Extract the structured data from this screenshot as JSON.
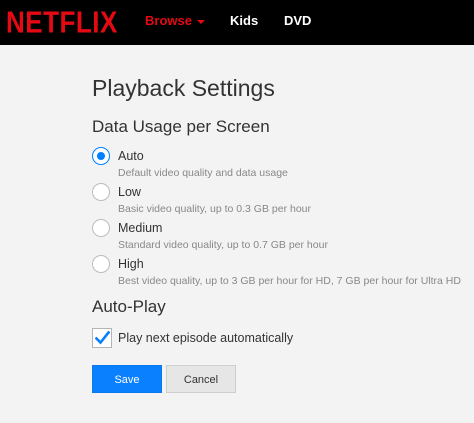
{
  "header": {
    "logo": "NETFLIX",
    "nav": [
      {
        "label": "Browse"
      },
      {
        "label": "Kids"
      },
      {
        "label": "DVD"
      }
    ]
  },
  "main": {
    "title": "Playback Settings",
    "data_usage": {
      "heading": "Data Usage per Screen",
      "options": [
        {
          "label": "Auto",
          "description": "Default video quality and data usage",
          "selected": true
        },
        {
          "label": "Low",
          "description": "Basic video quality, up to 0.3 GB per hour",
          "selected": false
        },
        {
          "label": "Medium",
          "description": "Standard video quality, up to 0.7 GB per hour",
          "selected": false
        },
        {
          "label": "High",
          "description": "Best video quality, up to 3 GB per hour for HD, 7 GB per hour for Ultra HD",
          "selected": false
        }
      ]
    },
    "autoplay": {
      "heading": "Auto-Play",
      "checkbox_label": "Play next episode automatically",
      "checked": true
    },
    "buttons": {
      "save": "Save",
      "cancel": "Cancel"
    }
  },
  "colors": {
    "brand": "#e50914",
    "accent": "#0a80ff",
    "background": "#f3f3f3",
    "topbar": "#000000"
  }
}
